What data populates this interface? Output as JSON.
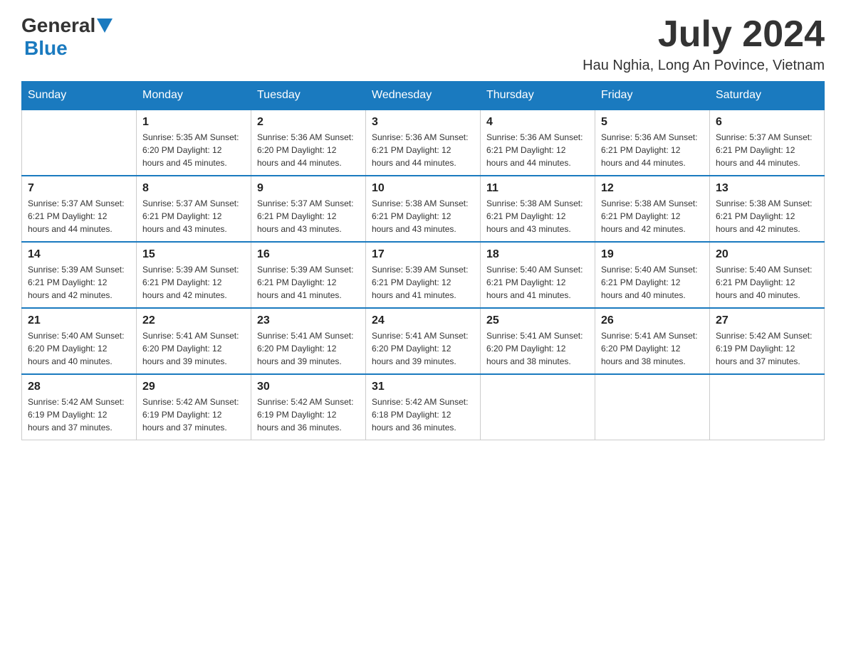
{
  "header": {
    "logo_general": "General",
    "logo_blue": "Blue",
    "month_year": "July 2024",
    "location": "Hau Nghia, Long An Povince, Vietnam"
  },
  "calendar": {
    "days_of_week": [
      "Sunday",
      "Monday",
      "Tuesday",
      "Wednesday",
      "Thursday",
      "Friday",
      "Saturday"
    ],
    "weeks": [
      [
        {
          "day": "",
          "info": ""
        },
        {
          "day": "1",
          "info": "Sunrise: 5:35 AM\nSunset: 6:20 PM\nDaylight: 12 hours\nand 45 minutes."
        },
        {
          "day": "2",
          "info": "Sunrise: 5:36 AM\nSunset: 6:20 PM\nDaylight: 12 hours\nand 44 minutes."
        },
        {
          "day": "3",
          "info": "Sunrise: 5:36 AM\nSunset: 6:21 PM\nDaylight: 12 hours\nand 44 minutes."
        },
        {
          "day": "4",
          "info": "Sunrise: 5:36 AM\nSunset: 6:21 PM\nDaylight: 12 hours\nand 44 minutes."
        },
        {
          "day": "5",
          "info": "Sunrise: 5:36 AM\nSunset: 6:21 PM\nDaylight: 12 hours\nand 44 minutes."
        },
        {
          "day": "6",
          "info": "Sunrise: 5:37 AM\nSunset: 6:21 PM\nDaylight: 12 hours\nand 44 minutes."
        }
      ],
      [
        {
          "day": "7",
          "info": "Sunrise: 5:37 AM\nSunset: 6:21 PM\nDaylight: 12 hours\nand 44 minutes."
        },
        {
          "day": "8",
          "info": "Sunrise: 5:37 AM\nSunset: 6:21 PM\nDaylight: 12 hours\nand 43 minutes."
        },
        {
          "day": "9",
          "info": "Sunrise: 5:37 AM\nSunset: 6:21 PM\nDaylight: 12 hours\nand 43 minutes."
        },
        {
          "day": "10",
          "info": "Sunrise: 5:38 AM\nSunset: 6:21 PM\nDaylight: 12 hours\nand 43 minutes."
        },
        {
          "day": "11",
          "info": "Sunrise: 5:38 AM\nSunset: 6:21 PM\nDaylight: 12 hours\nand 43 minutes."
        },
        {
          "day": "12",
          "info": "Sunrise: 5:38 AM\nSunset: 6:21 PM\nDaylight: 12 hours\nand 42 minutes."
        },
        {
          "day": "13",
          "info": "Sunrise: 5:38 AM\nSunset: 6:21 PM\nDaylight: 12 hours\nand 42 minutes."
        }
      ],
      [
        {
          "day": "14",
          "info": "Sunrise: 5:39 AM\nSunset: 6:21 PM\nDaylight: 12 hours\nand 42 minutes."
        },
        {
          "day": "15",
          "info": "Sunrise: 5:39 AM\nSunset: 6:21 PM\nDaylight: 12 hours\nand 42 minutes."
        },
        {
          "day": "16",
          "info": "Sunrise: 5:39 AM\nSunset: 6:21 PM\nDaylight: 12 hours\nand 41 minutes."
        },
        {
          "day": "17",
          "info": "Sunrise: 5:39 AM\nSunset: 6:21 PM\nDaylight: 12 hours\nand 41 minutes."
        },
        {
          "day": "18",
          "info": "Sunrise: 5:40 AM\nSunset: 6:21 PM\nDaylight: 12 hours\nand 41 minutes."
        },
        {
          "day": "19",
          "info": "Sunrise: 5:40 AM\nSunset: 6:21 PM\nDaylight: 12 hours\nand 40 minutes."
        },
        {
          "day": "20",
          "info": "Sunrise: 5:40 AM\nSunset: 6:21 PM\nDaylight: 12 hours\nand 40 minutes."
        }
      ],
      [
        {
          "day": "21",
          "info": "Sunrise: 5:40 AM\nSunset: 6:20 PM\nDaylight: 12 hours\nand 40 minutes."
        },
        {
          "day": "22",
          "info": "Sunrise: 5:41 AM\nSunset: 6:20 PM\nDaylight: 12 hours\nand 39 minutes."
        },
        {
          "day": "23",
          "info": "Sunrise: 5:41 AM\nSunset: 6:20 PM\nDaylight: 12 hours\nand 39 minutes."
        },
        {
          "day": "24",
          "info": "Sunrise: 5:41 AM\nSunset: 6:20 PM\nDaylight: 12 hours\nand 39 minutes."
        },
        {
          "day": "25",
          "info": "Sunrise: 5:41 AM\nSunset: 6:20 PM\nDaylight: 12 hours\nand 38 minutes."
        },
        {
          "day": "26",
          "info": "Sunrise: 5:41 AM\nSunset: 6:20 PM\nDaylight: 12 hours\nand 38 minutes."
        },
        {
          "day": "27",
          "info": "Sunrise: 5:42 AM\nSunset: 6:19 PM\nDaylight: 12 hours\nand 37 minutes."
        }
      ],
      [
        {
          "day": "28",
          "info": "Sunrise: 5:42 AM\nSunset: 6:19 PM\nDaylight: 12 hours\nand 37 minutes."
        },
        {
          "day": "29",
          "info": "Sunrise: 5:42 AM\nSunset: 6:19 PM\nDaylight: 12 hours\nand 37 minutes."
        },
        {
          "day": "30",
          "info": "Sunrise: 5:42 AM\nSunset: 6:19 PM\nDaylight: 12 hours\nand 36 minutes."
        },
        {
          "day": "31",
          "info": "Sunrise: 5:42 AM\nSunset: 6:18 PM\nDaylight: 12 hours\nand 36 minutes."
        },
        {
          "day": "",
          "info": ""
        },
        {
          "day": "",
          "info": ""
        },
        {
          "day": "",
          "info": ""
        }
      ]
    ]
  }
}
